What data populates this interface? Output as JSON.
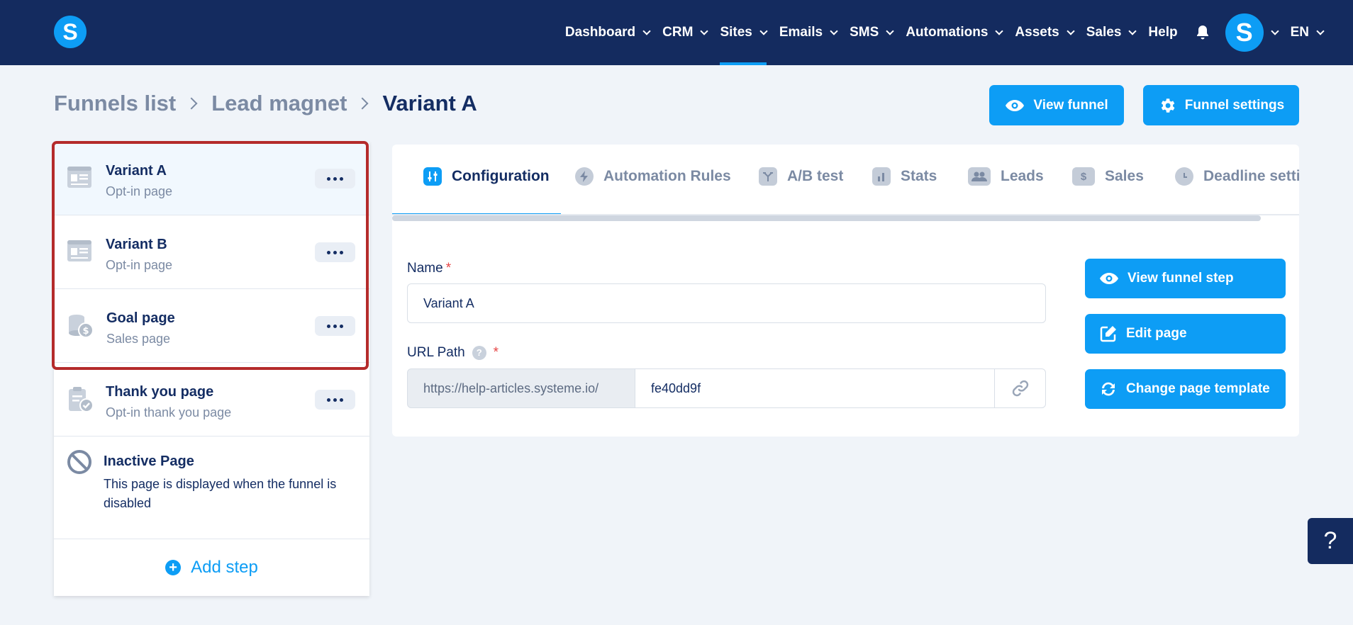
{
  "logo_letter": "S",
  "nav": {
    "items": [
      {
        "label": "Dashboard",
        "chevron": true
      },
      {
        "label": "CRM",
        "chevron": true
      },
      {
        "label": "Sites",
        "chevron": true,
        "active": true
      },
      {
        "label": "Emails",
        "chevron": true
      },
      {
        "label": "SMS",
        "chevron": true
      },
      {
        "label": "Automations",
        "chevron": true
      },
      {
        "label": "Assets",
        "chevron": true
      },
      {
        "label": "Sales",
        "chevron": true
      },
      {
        "label": "Help",
        "chevron": false
      }
    ],
    "avatar_letter": "S",
    "language": "EN"
  },
  "breadcrumb": {
    "funnels_list": "Funnels list",
    "funnel": "Lead magnet",
    "current": "Variant A"
  },
  "header_buttons": {
    "view_funnel": "View funnel",
    "funnel_settings": "Funnel settings"
  },
  "steps": [
    {
      "title": "Variant A",
      "subtitle": "Opt-in page",
      "icon": "page-layout-icon",
      "selected": true
    },
    {
      "title": "Variant B",
      "subtitle": "Opt-in page",
      "icon": "page-layout-icon"
    },
    {
      "title": "Goal page",
      "subtitle": "Sales page",
      "icon": "coins-dollar-icon"
    },
    {
      "title": "Thank you page",
      "subtitle": "Opt-in thank you page",
      "icon": "clipboard-check-icon"
    }
  ],
  "inactive_page": {
    "title": "Inactive Page",
    "description": "This page is displayed when the funnel is disabled"
  },
  "add_step": "Add step",
  "tabs": [
    {
      "label": "Configuration",
      "active": true,
      "icon": "sliders-icon"
    },
    {
      "label": "Automation Rules",
      "icon": "bolt-icon"
    },
    {
      "label": "A/B test",
      "icon": "split-icon"
    },
    {
      "label": "Stats",
      "icon": "bar-chart-icon"
    },
    {
      "label": "Leads",
      "icon": "users-icon"
    },
    {
      "label": "Sales",
      "icon": "dollar-icon"
    },
    {
      "label": "Deadline setti",
      "icon": "clock-icon"
    }
  ],
  "form": {
    "name_label": "Name",
    "name_value": "Variant A",
    "url_label": "URL Path",
    "url_prefix": "https://help-articles.systeme.io/",
    "url_value": "fe40dd9f",
    "required_mark": "*",
    "help_mark": "?"
  },
  "side_buttons": {
    "view_step": "View funnel step",
    "edit_page": "Edit page",
    "change_template": "Change page template"
  },
  "help_fab": "?",
  "colors": {
    "navy": "#142b5f",
    "accent": "#0d9df5",
    "highlight": "#b42b2b"
  }
}
